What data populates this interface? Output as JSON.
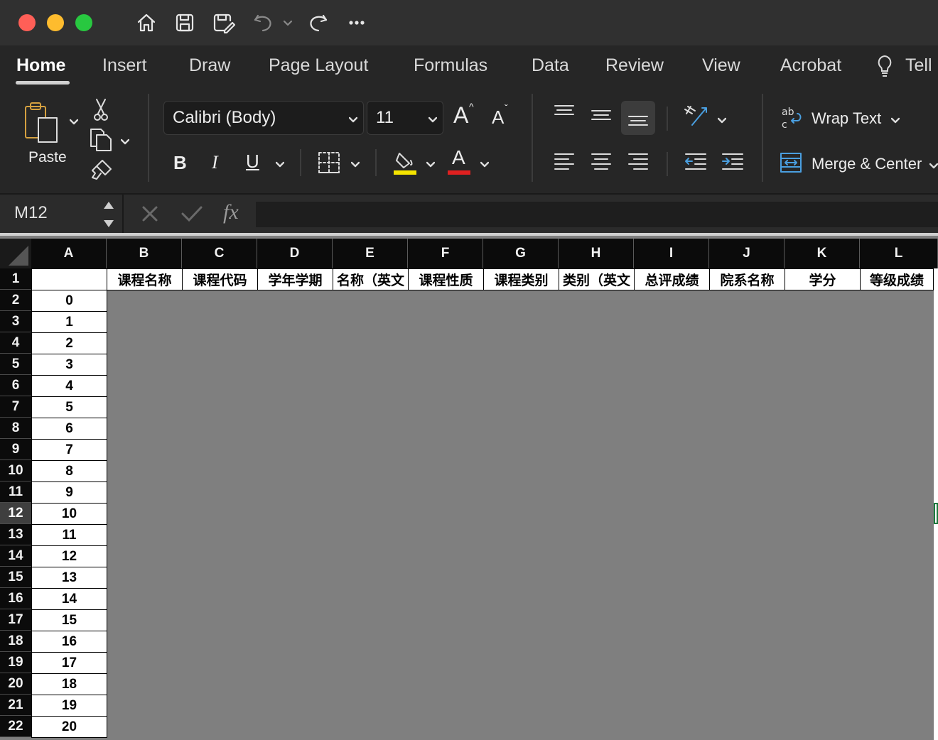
{
  "window": {
    "traffic_lights": {
      "close": "#ff5f57",
      "minimize": "#febc2e",
      "zoom": "#28c840"
    },
    "toolbar_icons": [
      "home-icon",
      "save-icon",
      "save-as-icon",
      "undo-icon",
      "chevron-down-icon",
      "redo-icon",
      "more-icon"
    ]
  },
  "ribbon_tabs": [
    "Home",
    "Insert",
    "Draw",
    "Page Layout",
    "Formulas",
    "Data",
    "Review",
    "View",
    "Acrobat",
    "Tell"
  ],
  "ribbon": {
    "paste_label": "Paste",
    "font_name": "Calibri (Body)",
    "font_size": "11",
    "bold": "B",
    "italic": "I",
    "underline": "U",
    "grow_font": "A",
    "shrink_font": "A",
    "font_color_glyph": "A",
    "wrap_text": "Wrap Text",
    "merge_center": "Merge & Center",
    "highlight_color": "#f5e400",
    "font_color": "#e02020"
  },
  "formula_bar": {
    "name_box": "M12",
    "fx": "fx",
    "value": ""
  },
  "sheet": {
    "columns": [
      "A",
      "B",
      "C",
      "D",
      "E",
      "F",
      "G",
      "H",
      "I",
      "J",
      "K",
      "L"
    ],
    "header_row": [
      "",
      "课程名称",
      "课程代码",
      "学年学期",
      "名称（英文",
      "课程性质",
      "课程类别",
      "类别（英文",
      "总评成绩",
      "院系名称",
      "学分",
      "等级成绩"
    ],
    "row_numbers": [
      "1",
      "2",
      "3",
      "4",
      "5",
      "6",
      "7",
      "8",
      "9",
      "10",
      "11",
      "12",
      "13",
      "14",
      "15",
      "16",
      "17",
      "18",
      "19",
      "20",
      "21",
      "22"
    ],
    "index_values": [
      "0",
      "1",
      "2",
      "3",
      "4",
      "5",
      "6",
      "7",
      "8",
      "9",
      "10",
      "11",
      "12",
      "13",
      "14",
      "15",
      "16",
      "17",
      "18",
      "19",
      "20"
    ],
    "selected_row": "12"
  }
}
